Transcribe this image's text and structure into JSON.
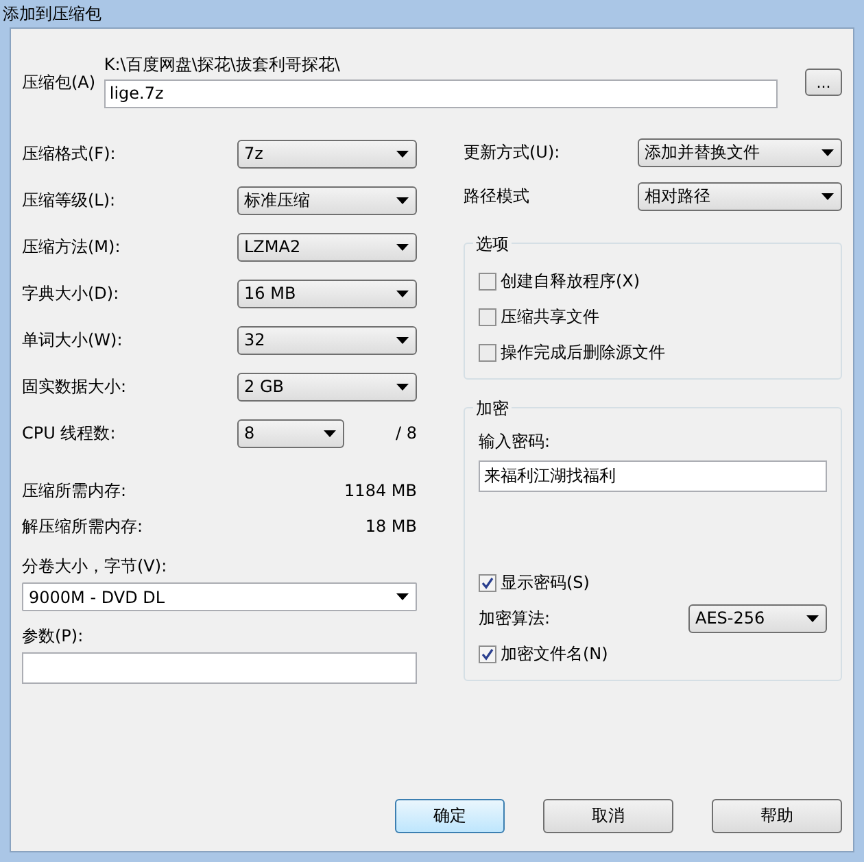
{
  "window": {
    "title": "添加到压缩包"
  },
  "archive": {
    "label": "压缩包(A)",
    "folder": "K:\\百度网盘\\探花\\拔套利哥探花\\",
    "value": "lige.7z",
    "browse": "..."
  },
  "settings": [
    {
      "label": "压缩格式(F):",
      "value": "7z"
    },
    {
      "label": "压缩等级(L):",
      "value": "标准压缩"
    },
    {
      "label": "压缩方法(M):",
      "value": "LZMA2"
    },
    {
      "label": "字典大小(D):",
      "value": "16 MB"
    },
    {
      "label": "单词大小(W):",
      "value": "32"
    },
    {
      "label": "固实数据大小:",
      "value": "2 GB"
    }
  ],
  "threads": {
    "label": "CPU 线程数:",
    "value": "8",
    "max": "/ 8"
  },
  "memory": [
    {
      "label": "压缩所需内存:",
      "value": "1184 MB"
    },
    {
      "label": "解压缩所需内存:",
      "value": "18 MB"
    }
  ],
  "volume": {
    "label": "分卷大小，字节(V):",
    "value": "9000M - DVD DL"
  },
  "parameters": {
    "label": "参数(P):"
  },
  "update_mode": {
    "label": "更新方式(U):",
    "value": "添加并替换文件"
  },
  "path_mode": {
    "label": "路径模式",
    "value": "相对路径"
  },
  "options": {
    "title": "选项",
    "items": [
      {
        "label": "创建自释放程序(X)",
        "checked": false
      },
      {
        "label": "压缩共享文件",
        "checked": false
      },
      {
        "label": "操作完成后删除源文件",
        "checked": false
      }
    ]
  },
  "encryption": {
    "title": "加密",
    "password_label": "输入密码:",
    "password": "来福利江湖找福利",
    "show_password": {
      "label": "显示密码(S)",
      "checked": true
    },
    "method_label": "加密算法:",
    "method": "AES-256",
    "encrypt_names": {
      "label": "加密文件名(N)",
      "checked": true
    }
  },
  "buttons": [
    {
      "label": "确定",
      "default": true
    },
    {
      "label": "取消",
      "default": false
    },
    {
      "label": "帮助",
      "default": false
    }
  ]
}
